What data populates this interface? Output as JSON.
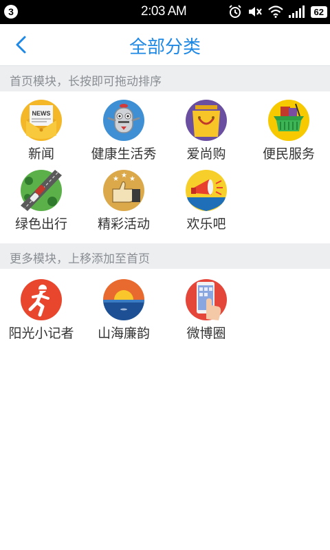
{
  "status_bar": {
    "notification_count": "3",
    "time": "2:03 AM",
    "battery": "62"
  },
  "header": {
    "title": "全部分类"
  },
  "sections": [
    {
      "heading": "首页模块，长按即可拖动排序",
      "items": [
        {
          "label": "新闻",
          "icon": "news-icon"
        },
        {
          "label": "健康生活秀",
          "icon": "robot-icon"
        },
        {
          "label": "爱尚购",
          "icon": "shopping-bag-icon"
        },
        {
          "label": "便民服务",
          "icon": "basket-icon"
        },
        {
          "label": "绿色出行",
          "icon": "road-car-icon"
        },
        {
          "label": "精彩活动",
          "icon": "thumbs-up-icon"
        },
        {
          "label": "欢乐吧",
          "icon": "megaphone-icon"
        }
      ]
    },
    {
      "heading": "更多模块，上移添加至首页",
      "items": [
        {
          "label": "阳光小记者",
          "icon": "runner-icon"
        },
        {
          "label": "山海廉韵",
          "icon": "sunset-sea-icon"
        },
        {
          "label": "微博圈",
          "icon": "phone-touch-icon"
        }
      ]
    }
  ]
}
